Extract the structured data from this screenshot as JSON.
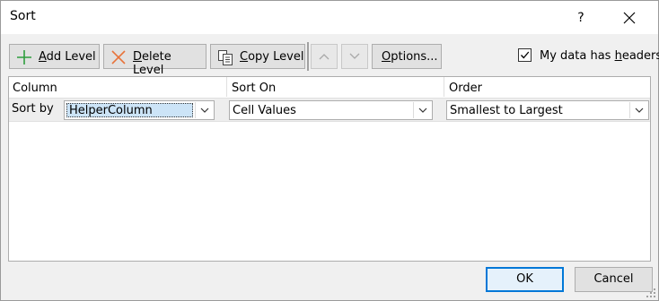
{
  "window": {
    "title": "Sort",
    "help_label": "?"
  },
  "toolbar": {
    "add_level": {
      "mnemonic": "A",
      "rest": "dd Level",
      "icon": "plus-icon"
    },
    "delete_level": {
      "mnemonic": "D",
      "rest": "elete Level",
      "icon": "delete-x-icon"
    },
    "copy_level": {
      "mnemonic": "C",
      "rest": "opy Level",
      "icon": "copy-icon"
    },
    "move_up": {
      "icon": "arrow-up-icon",
      "enabled": false
    },
    "move_down": {
      "icon": "arrow-down-icon",
      "enabled": false
    },
    "options": {
      "mnemonic": "O",
      "rest": "ptions..."
    }
  },
  "headers_checkbox": {
    "checked": true,
    "label_prefix": "My data has ",
    "label_mnemonic": "h",
    "label_suffix": "eaders"
  },
  "grid": {
    "columns": [
      "Column",
      "Sort On",
      "Order"
    ],
    "rows": [
      {
        "label": "Sort by",
        "column": "HelperColumn",
        "sort_on": "Cell Values",
        "order": "Smallest to Largest"
      }
    ]
  },
  "footer": {
    "ok_label": "OK",
    "cancel_label": "Cancel"
  },
  "colors": {
    "accent": "#0078d7",
    "selection": "#cce4f7",
    "add_icon": "#2e9e3e",
    "delete_icon": "#e8733a"
  }
}
